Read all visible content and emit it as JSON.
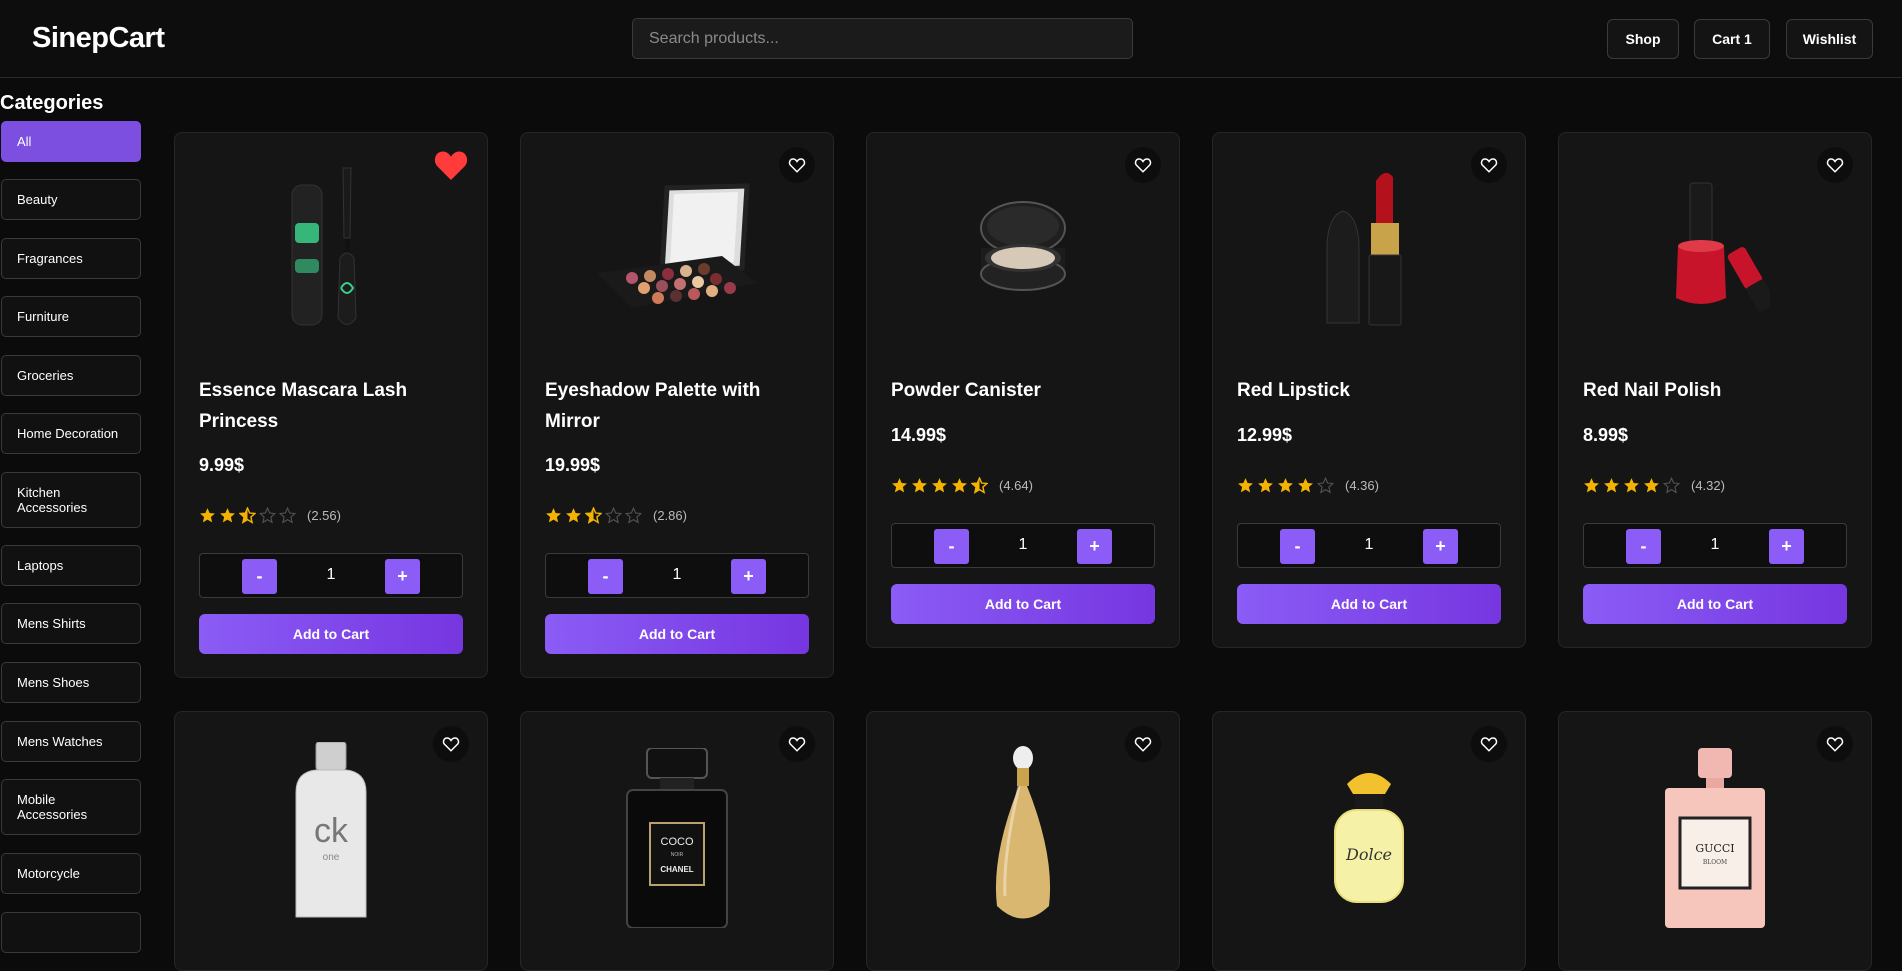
{
  "header": {
    "brand": "SinepCart",
    "search_placeholder": "Search products...",
    "nav": [
      {
        "label": "Shop"
      },
      {
        "label": "Cart 1"
      },
      {
        "label": "Wishlist"
      }
    ]
  },
  "sidebar": {
    "title": "Categories",
    "items": [
      {
        "label": "All",
        "active": true
      },
      {
        "label": "Beauty"
      },
      {
        "label": "Fragrances"
      },
      {
        "label": "Furniture"
      },
      {
        "label": "Groceries"
      },
      {
        "label": "Home Decoration"
      },
      {
        "label": "Kitchen Accessories"
      },
      {
        "label": "Laptops"
      },
      {
        "label": "Mens Shirts"
      },
      {
        "label": "Mens Shoes"
      },
      {
        "label": "Mens Watches"
      },
      {
        "label": "Mobile Accessories"
      },
      {
        "label": "Motorcycle"
      }
    ]
  },
  "product_card": {
    "add_label": "Add to Cart",
    "minus_label": "-",
    "plus_label": "+"
  },
  "products": [
    {
      "title": "Essence Mascara Lash Princess",
      "price": "9.99$",
      "rating": 2.56,
      "rating_text": "(2.56)",
      "qty": "1",
      "wishlisted": true,
      "image": "mascara"
    },
    {
      "title": "Eyeshadow Palette with Mirror",
      "price": "19.99$",
      "rating": 2.86,
      "rating_text": "(2.86)",
      "qty": "1",
      "wishlisted": false,
      "image": "palette"
    },
    {
      "title": "Powder Canister",
      "price": "14.99$",
      "rating": 4.64,
      "rating_text": "(4.64)",
      "qty": "1",
      "wishlisted": false,
      "image": "powder"
    },
    {
      "title": "Red Lipstick",
      "price": "12.99$",
      "rating": 4.36,
      "rating_text": "(4.36)",
      "qty": "1",
      "wishlisted": false,
      "image": "lipstick"
    },
    {
      "title": "Red Nail Polish",
      "price": "8.99$",
      "rating": 4.32,
      "rating_text": "(4.32)",
      "qty": "1",
      "wishlisted": false,
      "image": "nailpolish"
    },
    {
      "wishlisted": false,
      "image": "ck-one"
    },
    {
      "wishlisted": false,
      "image": "chanel-coco"
    },
    {
      "wishlisted": false,
      "image": "dior-jadore"
    },
    {
      "wishlisted": false,
      "image": "dolce"
    },
    {
      "wishlisted": false,
      "image": "gucci-bloom"
    }
  ],
  "product_images": {
    "ck-one": {
      "line1": "ck",
      "line2": "one"
    },
    "chanel-coco": {
      "line1": "COCO",
      "line2": "NOIR",
      "line3": "CHANEL"
    },
    "dolce": {
      "line1": "Dolce"
    },
    "gucci-bloom": {
      "line1": "GUCCI",
      "line2": "BLOOM"
    }
  },
  "colors": {
    "accent": "#8b5cf6",
    "star": "#f5b301",
    "heart_active": "#ff3b3b"
  }
}
